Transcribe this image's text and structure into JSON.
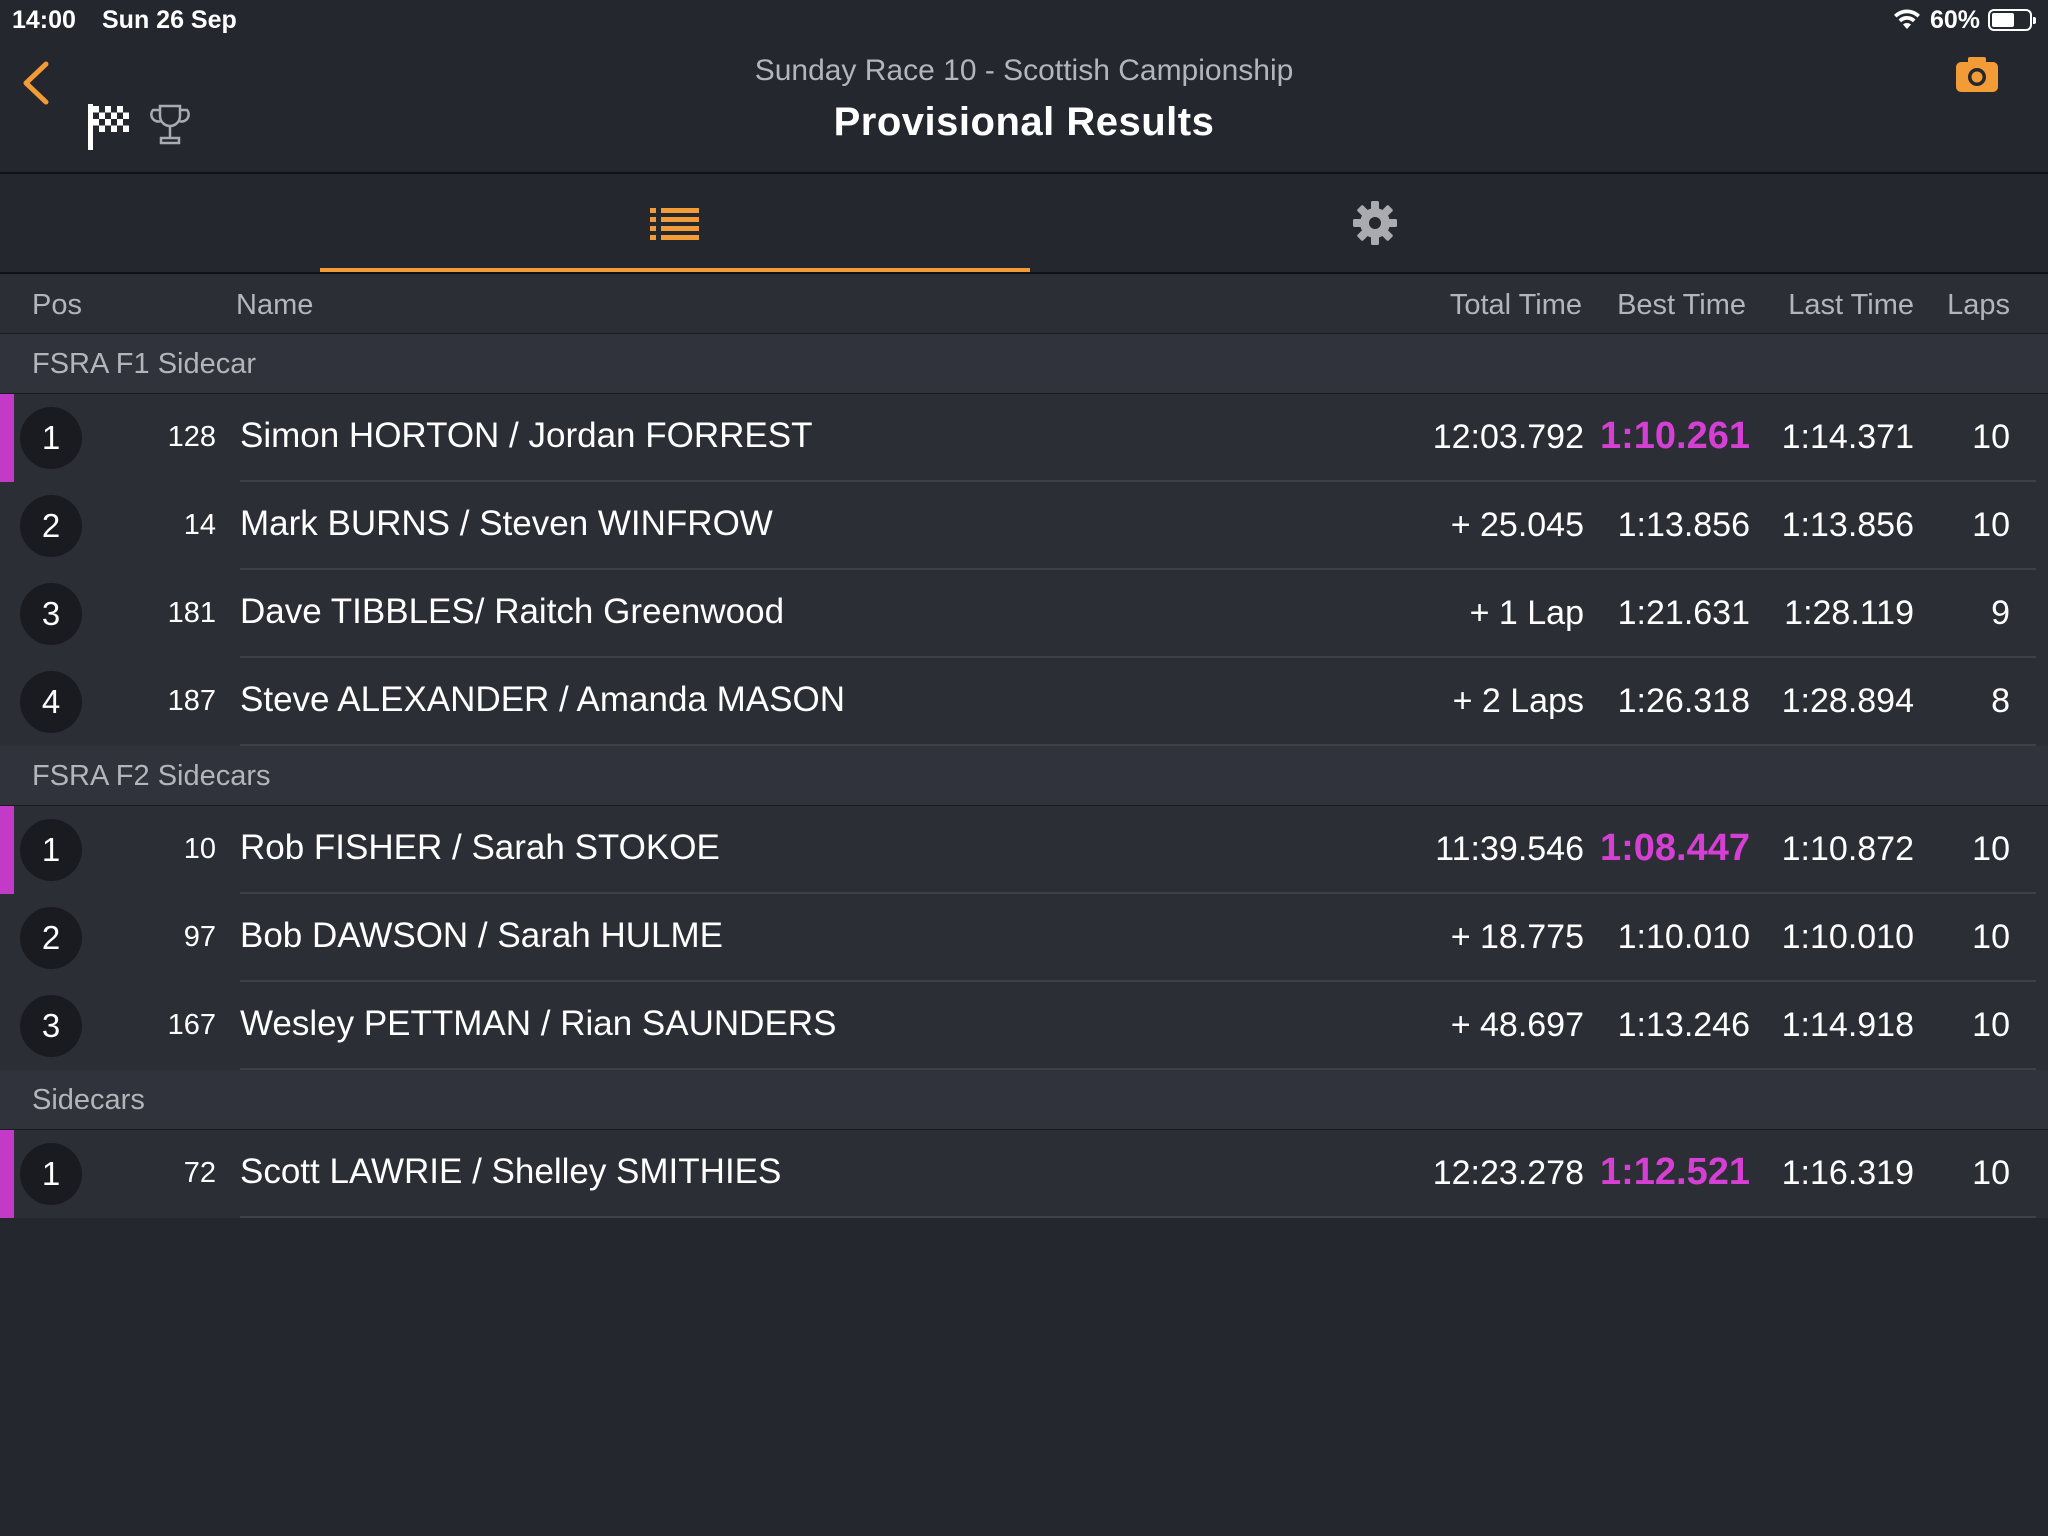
{
  "status": {
    "time": "14:00",
    "date": "Sun 26 Sep",
    "battery": "60%",
    "battery_level": 0.6
  },
  "header": {
    "subtitle": "Sunday Race 10 - Scottish Campionship",
    "title": "Provisional Results"
  },
  "columns": {
    "pos": "Pos",
    "name": "Name",
    "total": "Total Time",
    "best": "Best Time",
    "last": "Last Time",
    "laps": "Laps"
  },
  "colors": {
    "accent": "#f29c38",
    "leader": "#c23ac6",
    "fastest": "#d63fd4"
  },
  "sections": [
    {
      "name": "FSRA F1 Sidecar",
      "rows": [
        {
          "pos": "1",
          "num": "128",
          "name": "Simon HORTON / Jordan FORREST",
          "total": "12:03.792",
          "best": "1:10.261",
          "last": "1:14.371",
          "laps": "10",
          "fastest": true
        },
        {
          "pos": "2",
          "num": "14",
          "name": "Mark BURNS / Steven WINFROW",
          "total": "+ 25.045",
          "best": "1:13.856",
          "last": "1:13.856",
          "laps": "10",
          "fastest": false
        },
        {
          "pos": "3",
          "num": "181",
          "name": "Dave TIBBLES/ Raitch Greenwood",
          "total": "+ 1 Lap",
          "best": "1:21.631",
          "last": "1:28.119",
          "laps": "9",
          "fastest": false
        },
        {
          "pos": "4",
          "num": "187",
          "name": "Steve ALEXANDER / Amanda MASON",
          "total": "+ 2 Laps",
          "best": "1:26.318",
          "last": "1:28.894",
          "laps": "8",
          "fastest": false
        }
      ]
    },
    {
      "name": "FSRA F2 Sidecars",
      "rows": [
        {
          "pos": "1",
          "num": "10",
          "name": "Rob FISHER / Sarah STOKOE",
          "total": "11:39.546",
          "best": "1:08.447",
          "last": "1:10.872",
          "laps": "10",
          "fastest": true
        },
        {
          "pos": "2",
          "num": "97",
          "name": "Bob DAWSON / Sarah HULME",
          "total": "+ 18.775",
          "best": "1:10.010",
          "last": "1:10.010",
          "laps": "10",
          "fastest": false
        },
        {
          "pos": "3",
          "num": "167",
          "name": "Wesley PETTMAN / Rian SAUNDERS",
          "total": "+ 48.697",
          "best": "1:13.246",
          "last": "1:14.918",
          "laps": "10",
          "fastest": false
        }
      ]
    },
    {
      "name": "Sidecars",
      "rows": [
        {
          "pos": "1",
          "num": "72",
          "name": "Scott LAWRIE / Shelley SMITHIES",
          "total": "12:23.278",
          "best": "1:12.521",
          "last": "1:16.319",
          "laps": "10",
          "fastest": true
        }
      ]
    }
  ]
}
